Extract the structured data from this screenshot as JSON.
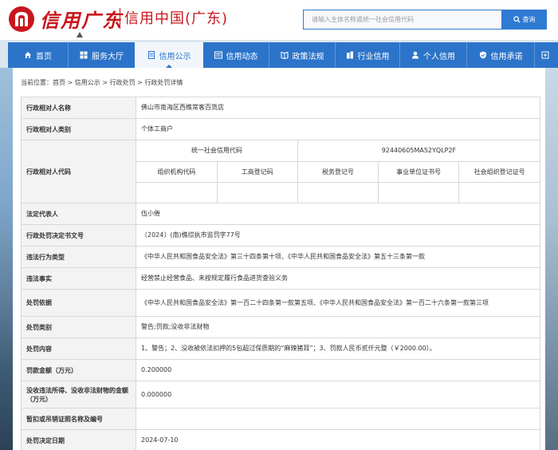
{
  "header": {
    "logo_script": "信用广东",
    "logo_title": "信用中国(广东)",
    "search_placeholder": "请输入主体名称或统一社会信用代码",
    "search_button": "查询"
  },
  "nav": {
    "items": [
      {
        "label": "首页",
        "icon": "home-icon"
      },
      {
        "label": "服务大厅",
        "icon": "grid-icon"
      },
      {
        "label": "信用公示",
        "icon": "document-icon"
      },
      {
        "label": "信用动态",
        "icon": "news-icon"
      },
      {
        "label": "政策法规",
        "icon": "book-icon"
      },
      {
        "label": "行业信用",
        "icon": "building-icon"
      },
      {
        "label": "个人信用",
        "icon": "person-icon"
      },
      {
        "label": "信用承诺",
        "icon": "shield-icon"
      }
    ],
    "active_index": 2
  },
  "breadcrumb": {
    "prefix": "当前位置：",
    "items": [
      "首页",
      "信用公示",
      "行政处罚",
      "行政处罚详情"
    ],
    "separator": " > "
  },
  "detail": {
    "name_label": "行政相对人名称",
    "name_value": "佛山市南海区西樵常客百货店",
    "type_label": "行政相对人类别",
    "type_value": "个体工商户",
    "code_label": "行政相对人代码",
    "uscc_label": "统一社会信用代码",
    "uscc_value": "92440605MA52YQLP2F",
    "code_headers": [
      "组织机构代码",
      "工商登记码",
      "税务登记号",
      "事业单位证书号",
      "社会组织登记证号"
    ],
    "code_values": [
      "",
      "",
      "",
      "",
      ""
    ],
    "rows": [
      {
        "label": "法定代表人",
        "value": "伍小倦"
      },
      {
        "label": "行政处罚决定书文号",
        "value": "〔2024〕(南)樵综执市监罚字77号"
      },
      {
        "label": "违法行为类型",
        "value": "《中华人民共和国食品安全法》第三十四条第十项、《中华人民共和国食品安全法》第五十三条第一款"
      },
      {
        "label": "违法事实",
        "value": "经营禁止经营食品、未按规定履行食品进货查验义务"
      },
      {
        "label": "处罚依据",
        "value": "《中华人民共和国食品安全法》第一百二十四条第一款第五项、《中华人民共和国食品安全法》第一百二十六条第一款第三项"
      },
      {
        "label": "处罚类别",
        "value": "警告;罚款;没收非法财物"
      },
      {
        "label": "处罚内容",
        "value": "1、警告；2、没收被依法扣押的5包超过保质期的“麻辣猪耳”；3、罚款人民币贰仟元整（￥2000.00）。"
      },
      {
        "label": "罚款金额（万元）",
        "value": "0.200000"
      },
      {
        "label": "没收违法所得、没收非法财物的金额（万元）",
        "value": "0.000000"
      },
      {
        "label": "暂扣或吊销证照名称及编号",
        "value": ""
      },
      {
        "label": "处罚决定日期",
        "value": "2024-07-10"
      }
    ]
  },
  "colors": {
    "brand_red": "#c8161d",
    "nav_blue": "#2b74c9",
    "label_bg": "#f3f3f3"
  }
}
